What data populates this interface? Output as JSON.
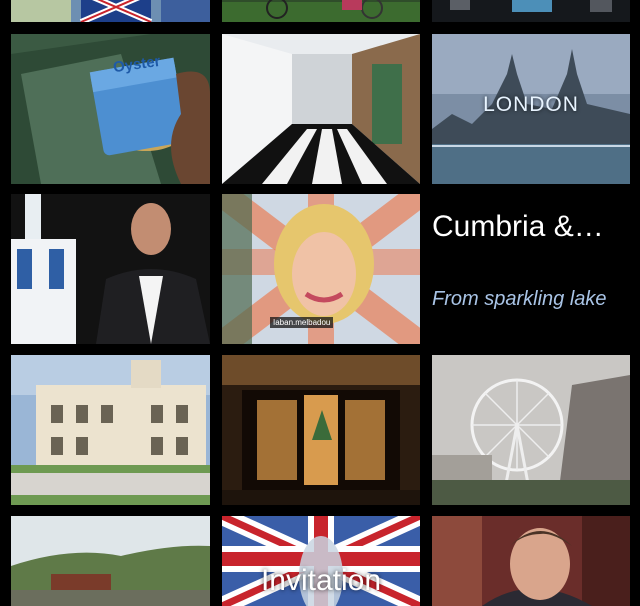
{
  "grid": {
    "feature_tile": {
      "title": "Cumbria &…",
      "subtitle": "From sparkling lake"
    },
    "tiles": {
      "oyster_card_label": "Oyster",
      "london_caption": "LONDON",
      "name_banner": "Iaban.melbadou",
      "invitation_caption": "Invitation"
    }
  }
}
